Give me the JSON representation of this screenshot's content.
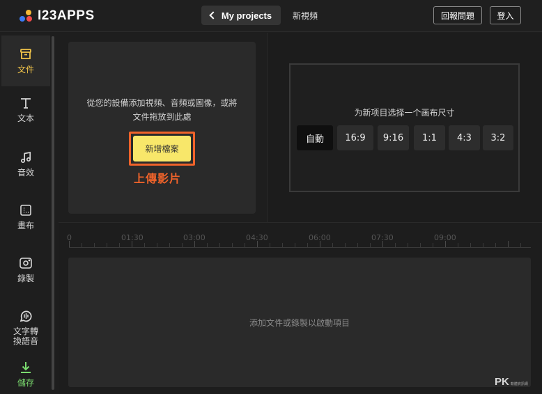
{
  "colors": {
    "accent_yellow": "#f8e76a",
    "active_label": "#f3c64a",
    "save_green": "#7bdc6f",
    "annotation_orange": "#f0632a",
    "logo_dots": [
      "#f04a4a",
      "#3b7bf5",
      "#f5b935"
    ]
  },
  "header": {
    "logo_text": "I23APPS",
    "back_button_label": "My projects",
    "project_name": "新視頻",
    "report_button_label": "回報問題",
    "login_button_label": "登入"
  },
  "sidebar": {
    "items": [
      {
        "label": "文件",
        "icon": "archive-box-icon",
        "active": true
      },
      {
        "label": "文本",
        "icon": "text-t-icon",
        "active": false
      },
      {
        "label": "音效",
        "icon": "music-note-icon",
        "active": false
      },
      {
        "label": "畫布",
        "icon": "canvas-icon",
        "active": false
      },
      {
        "label": "錄製",
        "icon": "camera-record-icon",
        "active": false
      },
      {
        "label": "文字轉\n換語音",
        "icon": "speech-wave-icon",
        "active": false
      },
      {
        "label": "儲存",
        "icon": "download-icon",
        "active": false
      }
    ]
  },
  "upload": {
    "hint_line1": "從您的設備添加視頻、音頻或圖像，或將",
    "hint_line2": "文件拖放到此處",
    "add_file_label": "新增檔案",
    "annotation": "上傳影片"
  },
  "canvas": {
    "title": "为新项目选择一个画布尺寸",
    "ratios": [
      "自動",
      "16:9",
      "9:16",
      "1:1",
      "4:3",
      "3:2"
    ],
    "selected_ratio": "自動"
  },
  "timeline": {
    "ruler_labels": [
      "0",
      "01:30",
      "03:00",
      "04:30",
      "06:00",
      "07:30",
      "09:00"
    ],
    "track_hint": "添加文件或錄製以啟動項目"
  },
  "watermark": {
    "big": "PK",
    "small": "軟體資訊網"
  }
}
